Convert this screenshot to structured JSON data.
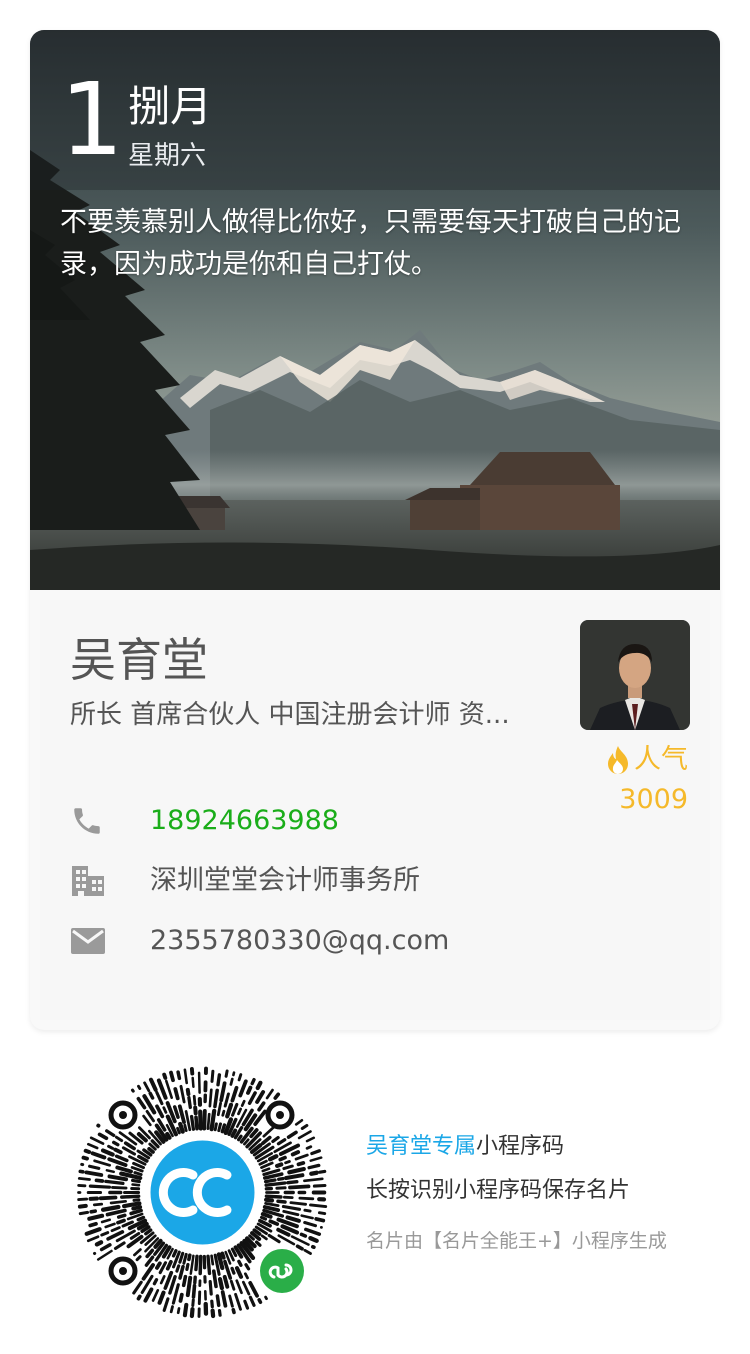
{
  "hero": {
    "day": "1",
    "month": "捌月",
    "weekday": "星期六",
    "quote": "不要羡慕别人做得比你好，只需要每天打破自己的记录，因为成功是你和自己打仗。"
  },
  "profile": {
    "name": "吴育堂",
    "titles": "所长 首席合伙人 中国注册会计师 资...",
    "popularity_label": "人气",
    "popularity_count": "3009",
    "phone": "18924663988",
    "company": "深圳堂堂会计师事务所",
    "email": "2355780330@qq.com"
  },
  "footer": {
    "highlight": "吴育堂专属",
    "line1_rest": "小程序码",
    "line2": "长按识别小程序码保存名片",
    "line3": "名片由【名片全能王+】小程序生成"
  },
  "colors": {
    "phone": "#1aad19",
    "popularity": "#f5b92a",
    "accent": "#1ba7e7",
    "wechat_badge": "#2aae48"
  },
  "icons": {
    "phone": "phone-icon",
    "company": "building-icon",
    "email": "mail-icon",
    "popularity": "flame-icon",
    "qr_center": "cc-logo-icon",
    "qr_badge": "miniprogram-badge-icon"
  }
}
